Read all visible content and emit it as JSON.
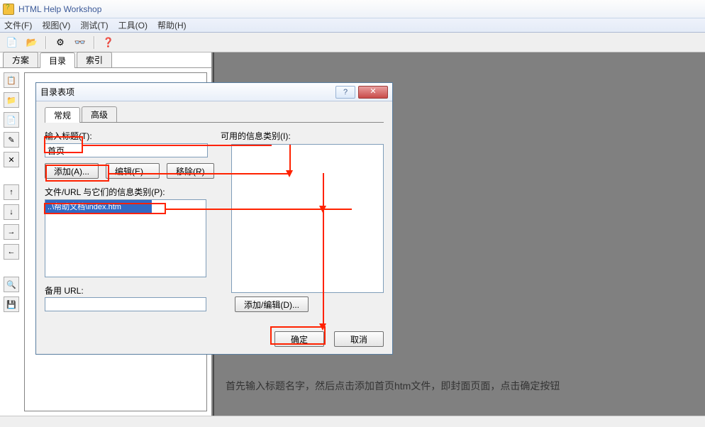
{
  "titlebar": {
    "title": "HTML Help Workshop"
  },
  "menubar": {
    "file": "文件(F)",
    "view": "视图(V)",
    "test": "测试(T)",
    "tools": "工具(O)",
    "help": "帮助(H)"
  },
  "lefttabs": {
    "project": "方案",
    "contents": "目录",
    "index": "索引"
  },
  "dialog": {
    "title": "目录表项",
    "tab_general": "常规",
    "tab_advanced": "高级",
    "title_label": "输入标题(T):",
    "title_value": "首页",
    "info_label": "可用的信息类别(I):",
    "add_btn": "添加(A)...",
    "edit_btn": "编辑(E)...",
    "remove_btn": "移除(R)",
    "files_label": "文件/URL 与它们的信息类别(P):",
    "selected_file": "..\\帮助文档\\index.htm",
    "alt_label": "备用 URL:",
    "addedit_btn": "添加/编辑(D)...",
    "ok": "确定",
    "cancel": "取消"
  },
  "annotation": "首先输入标题名字，然后点击添加首页htm文件，即封面页面，点击确定按钮"
}
